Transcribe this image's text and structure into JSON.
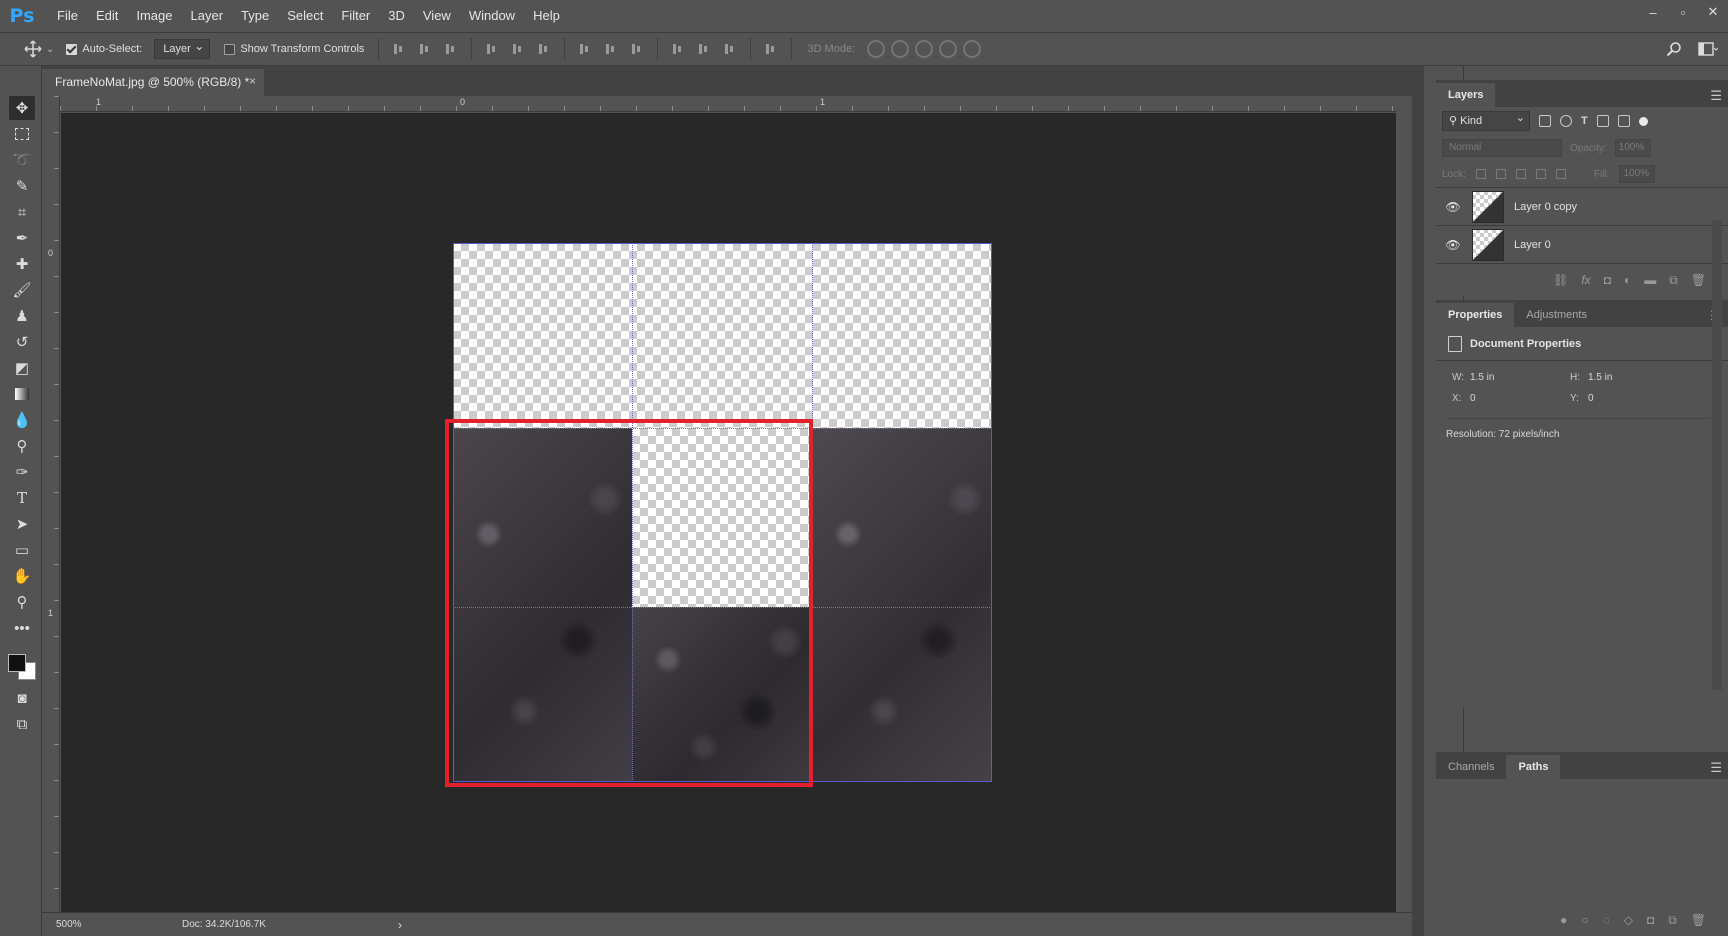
{
  "app": {
    "logo": "Ps"
  },
  "menu": [
    "File",
    "Edit",
    "Image",
    "Layer",
    "Type",
    "Select",
    "Filter",
    "3D",
    "View",
    "Window",
    "Help"
  ],
  "window_controls": {
    "minimize": "–",
    "restore": "▫",
    "close": "✕"
  },
  "options_bar": {
    "move_icon": "move-icon",
    "auto_select_label": "Auto-Select:",
    "auto_select_checked": true,
    "auto_select_target": "Layer",
    "show_transform_label": "Show Transform Controls",
    "show_transform_checked": false,
    "mode_3d_label": "3D Mode:"
  },
  "document": {
    "tab_title": "FrameNoMat.jpg @ 500% (RGB/8) *",
    "tab_close": "×",
    "zoom": "500%",
    "doc_size": "Doc: 34.2K/106.7K",
    "status_arrow": "›",
    "ruler_top_labels": [
      "1",
      "0",
      "1"
    ],
    "ruler_left_labels": [
      "0",
      "1"
    ]
  },
  "tools": [
    "move-tool",
    "marquee-tool",
    "lasso-tool",
    "quick-select-tool",
    "crop-tool",
    "eyedropper-tool",
    "healing-brush-tool",
    "brush-tool",
    "clone-stamp-tool",
    "history-brush-tool",
    "eraser-tool",
    "gradient-tool",
    "blur-tool",
    "dodge-tool",
    "pen-tool",
    "type-tool",
    "path-select-tool",
    "rectangle-tool",
    "hand-tool",
    "zoom-tool",
    "more-tools"
  ],
  "colors": {
    "accent": "#31a8ff",
    "highlight": "#e3202e",
    "grid": "#6f6fd6",
    "foreground": "#111111",
    "background": "#ffffff"
  },
  "layers_panel": {
    "tab": "Layers",
    "kind_filter": "Kind",
    "blend_mode": "Normal",
    "opacity_label": "Opacity:",
    "opacity_value": "100%",
    "lock_label": "Lock:",
    "fill_label": "Fill:",
    "fill_value": "100%",
    "layers": [
      {
        "name": "Layer 0 copy",
        "visible": true
      },
      {
        "name": "Layer 0",
        "visible": true
      }
    ]
  },
  "properties_panel": {
    "tabs": [
      "Properties",
      "Adjustments"
    ],
    "section_title": "Document Properties",
    "w_label": "W:",
    "w_value": "1.5 in",
    "h_label": "H:",
    "h_value": "1.5 in",
    "x_label": "X:",
    "x_value": "0",
    "y_label": "Y:",
    "y_value": "0",
    "resolution": "Resolution: 72 pixels/inch"
  },
  "paths_panel": {
    "tabs": [
      "Channels",
      "Paths"
    ],
    "active": "Paths"
  }
}
